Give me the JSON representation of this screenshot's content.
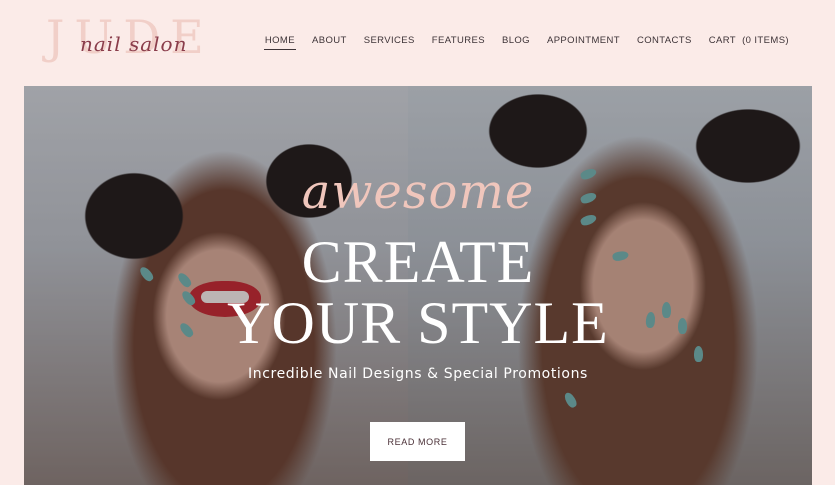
{
  "brand": {
    "logo_big": "JUDE",
    "logo_script": "nail salon"
  },
  "nav": {
    "items": [
      {
        "label": "HOME",
        "active": true
      },
      {
        "label": "ABOUT",
        "active": false
      },
      {
        "label": "SERVICES",
        "active": false
      },
      {
        "label": "FEATURES",
        "active": false
      },
      {
        "label": "BLOG",
        "active": false
      },
      {
        "label": "APPOINTMENT",
        "active": false
      },
      {
        "label": "CONTACTS",
        "active": false
      }
    ],
    "cart_label": "CART",
    "cart_count": "(0 ITEMS)"
  },
  "hero": {
    "tagline": "awesome",
    "headline_line1": "CREATE",
    "headline_line2": "YOUR STYLE",
    "subtitle": "Incredible Nail Designs & Special Promotions",
    "cta_label": "READ MORE"
  },
  "colors": {
    "background": "#fbebe8",
    "accent_pink": "#f0c6bc",
    "logo_script": "#8a3d4b",
    "nail_polish": "#6fb3b1"
  }
}
